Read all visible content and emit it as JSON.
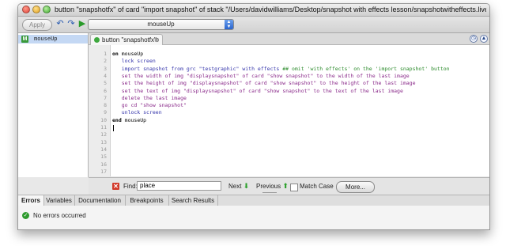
{
  "window": {
    "title": "button \"snapshotfx\" of card \"import snapshot\" of stack \"/Users/davidwilliams/Desktop/snapshot with effects lesson/snapshotwitheffects.livecode\" –..."
  },
  "toolbar": {
    "apply_label": "Apply",
    "handler_selected": "mouseUp"
  },
  "sidebar": {
    "items": [
      {
        "label": "mouseUp",
        "icon": "handler-icon",
        "color": "#3a9a3a"
      }
    ]
  },
  "editor": {
    "tab_label": "button \"snapshotfx\"",
    "tab_close": "⊗",
    "line_numbers": [
      "1",
      "2",
      "3",
      "4",
      "5",
      "6",
      "7",
      "8",
      "9",
      "10",
      "11",
      "12",
      "13",
      "14",
      "15",
      "16",
      "17"
    ],
    "lines": [
      [
        {
          "t": "on",
          "c": "kw"
        },
        {
          "t": " mouseUp",
          "c": "id"
        }
      ],
      [
        {
          "t": "   lock screen",
          "c": "cmd"
        }
      ],
      [
        {
          "t": "   import snapshot from grc \"testgraphic\" with effects ",
          "c": "cmd"
        },
        {
          "t": "## omit 'with effects' on the 'import snapshot' button",
          "c": "cm"
        }
      ],
      [
        {
          "t": "   set the width of img \"displaysnapshot\" of card \"show snapshot\" to the width of the last image",
          "c": "prop"
        }
      ],
      [
        {
          "t": "   set the height of img \"displaysnapshot\" of card \"show snapshot\" to the height of the last image",
          "c": "prop"
        }
      ],
      [
        {
          "t": "   set the text of img \"displaysnapshot\" of card \"show snapshot\" to the text of the last image",
          "c": "prop"
        }
      ],
      [
        {
          "t": "   delete the last image",
          "c": "prop"
        }
      ],
      [
        {
          "t": "   go cd \"show snapshot\"",
          "c": "prop"
        }
      ],
      [
        {
          "t": "   unlock screen",
          "c": "cmd"
        }
      ],
      [
        {
          "t": "end",
          "c": "kw"
        },
        {
          "t": " mouseUp",
          "c": "id"
        }
      ]
    ]
  },
  "find": {
    "label": "Find:",
    "value": "place",
    "next_label": "Next",
    "previous_label": "Previous",
    "match_case_label": "Match Case",
    "more_label": "More..."
  },
  "bottom_tabs": [
    "Errors",
    "Variables",
    "Documentation",
    "Breakpoints",
    "Search Results"
  ],
  "status": {
    "message": "No errors occurred"
  },
  "colors": {
    "kw": "#000000",
    "id": "#000000",
    "cmd": "#3333aa",
    "prop": "#8a2a8a",
    "cm": "#2a8a2a",
    "selection": "#c4d8f4"
  }
}
